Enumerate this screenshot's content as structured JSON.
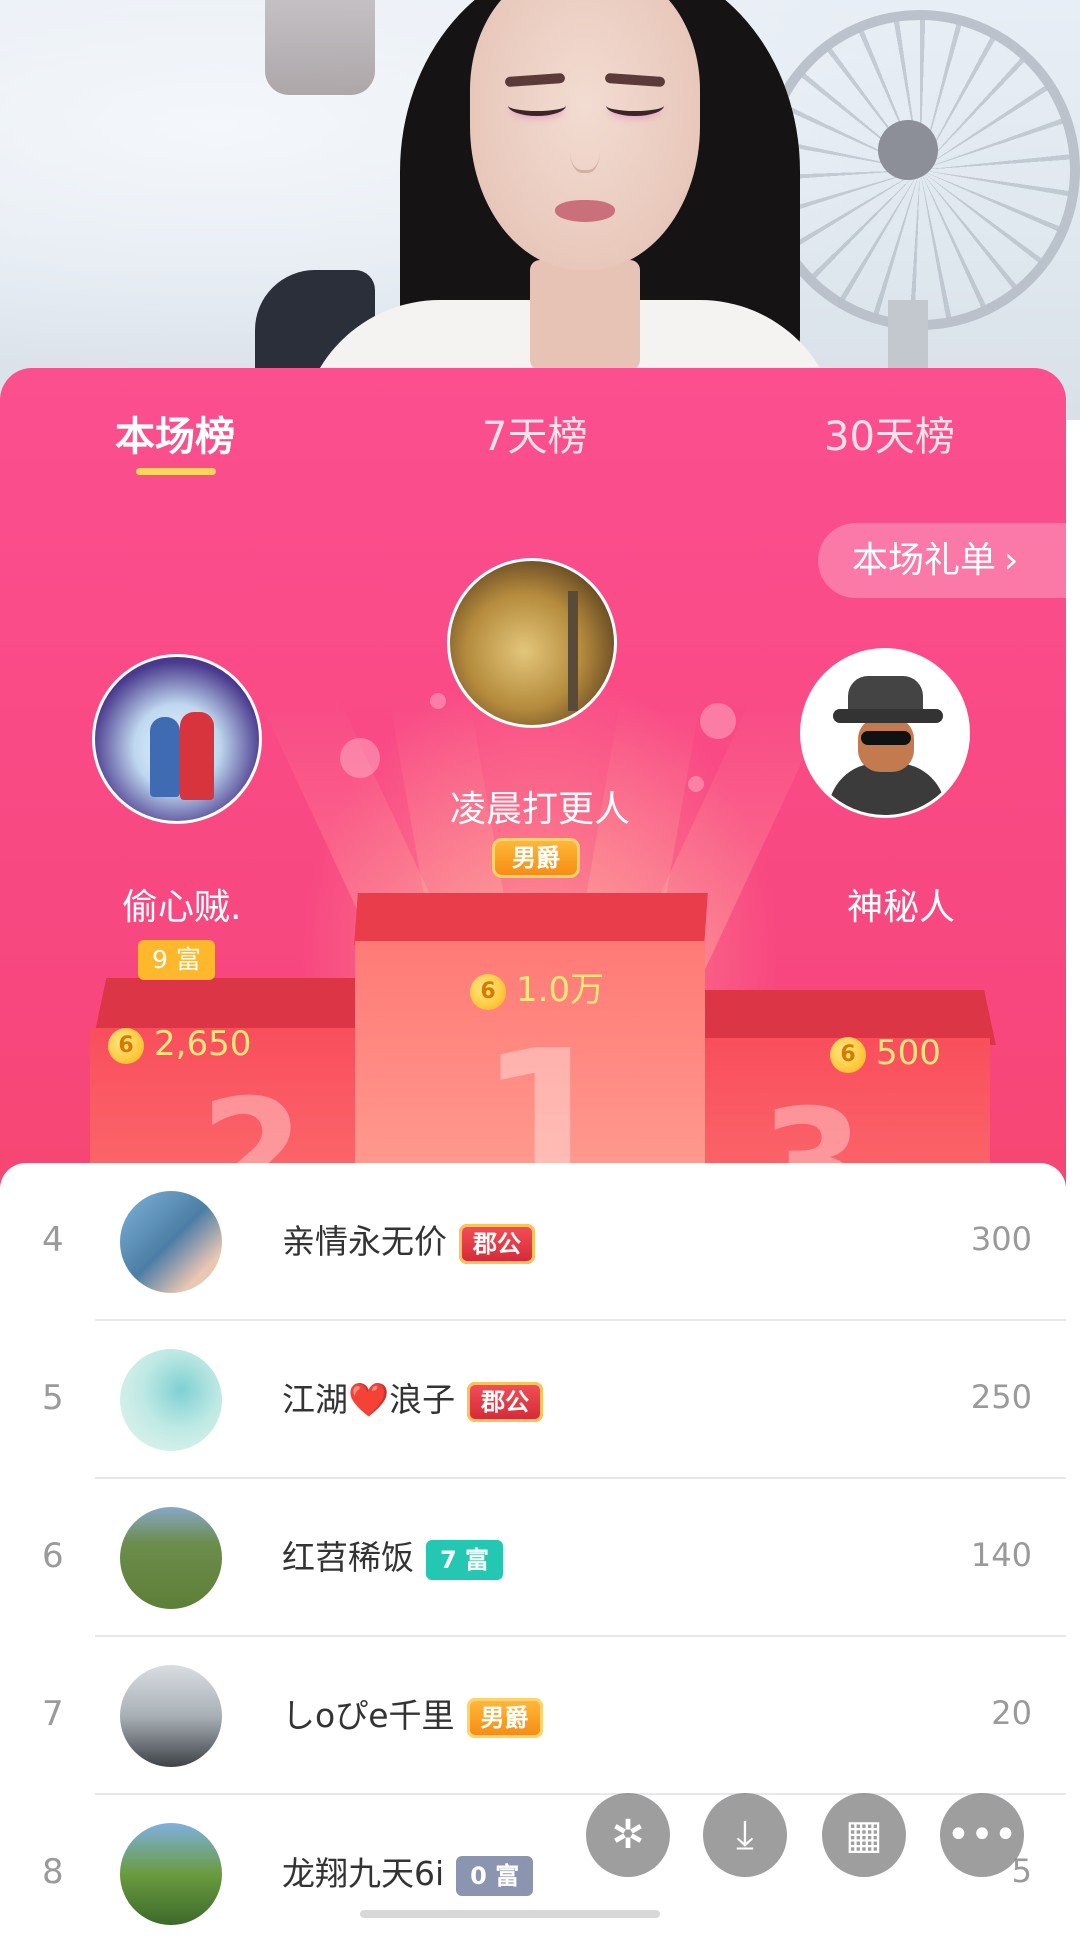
{
  "tabs": [
    {
      "label": "本场榜",
      "active": true
    },
    {
      "label": "7天榜",
      "active": false
    },
    {
      "label": "30天榜",
      "active": false
    }
  ],
  "gift_list_button": {
    "label": "本场礼单",
    "icon": "chevron-right-icon"
  },
  "podium": {
    "first": {
      "rank": "1",
      "name": "凌晨打更人",
      "badge": "男爵",
      "score": "1.0万"
    },
    "second": {
      "rank": "2",
      "name": "偷心贼.",
      "badge": "9 富",
      "score": "2,650"
    },
    "third": {
      "rank": "3",
      "name": "神秘人",
      "score": "500"
    }
  },
  "coin_symbol": "6",
  "list": [
    {
      "rank": "4",
      "name": "亲情永无价",
      "badge": "郡公",
      "score": "300"
    },
    {
      "rank": "5",
      "name": "江湖❤️浪子",
      "badge": "郡公",
      "score": "250"
    },
    {
      "rank": "6",
      "name": "红苕稀饭",
      "badge": "7 富",
      "score": "140"
    },
    {
      "rank": "7",
      "name": "しoぴe千里",
      "badge": "男爵",
      "score": "20"
    },
    {
      "rank": "8",
      "name": "龙翔九天6i",
      "badge": "0 富",
      "score": "5"
    }
  ],
  "floating_buttons": [
    {
      "icon": "sparkle-icon",
      "glyph": "✲"
    },
    {
      "icon": "download-icon",
      "glyph": "⤓"
    },
    {
      "icon": "grid-icon",
      "glyph": "▦"
    },
    {
      "icon": "more-icon",
      "glyph": "•••"
    }
  ],
  "colors": {
    "panel_top": "#fb4f8f",
    "panel_bottom": "#ee3f4a",
    "tab_underline": "#ffd45c",
    "score_text": "#ffe77a"
  }
}
